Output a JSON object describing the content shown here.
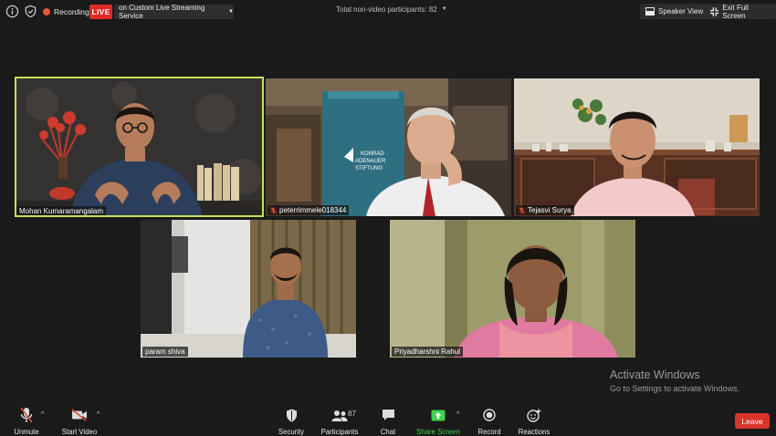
{
  "topbar": {
    "info_icon": "info-icon",
    "shield_icon": "shield-check-icon",
    "recording_label": "Recording",
    "live_badge": "LIVE",
    "live_service_label": "on Custom Live Streaming Service",
    "non_video_participants": "Total non-video participants: 82",
    "speaker_view_label": "Speaker View",
    "exit_fullscreen_label": "Exit Full Screen"
  },
  "participants": [
    {
      "name": "Mohan Kumaramangalam",
      "muted": false,
      "active_speaker": true
    },
    {
      "name": "peterrimmele018344",
      "muted": true,
      "active_speaker": false
    },
    {
      "name": "Tejasvi Surya",
      "muted": true,
      "active_speaker": false
    },
    {
      "name": "param shiva",
      "muted": false,
      "active_speaker": false
    },
    {
      "name": "Priyadharshni Rahul",
      "muted": false,
      "active_speaker": false
    }
  ],
  "backdrop_text": [
    "KONRAD",
    "ADENAUER",
    "STIFTUNG"
  ],
  "watermark": {
    "title": "Activate Windows",
    "subtitle": "Go to Settings to activate Windows."
  },
  "toolbar": {
    "unmute_label": "Unmute",
    "start_video_label": "Start Video",
    "security_label": "Security",
    "participants_label": "Participants",
    "participants_count": "87",
    "chat_label": "Chat",
    "share_screen_label": "Share Screen",
    "record_label": "Record",
    "reactions_label": "Reactions",
    "leave_label": "Leave"
  },
  "colors": {
    "background": "#1a1a1a",
    "live_red": "#e02828",
    "active_speaker_border": "#c7e05a",
    "share_green": "#3fd24a",
    "leave_red": "#d9342b"
  }
}
